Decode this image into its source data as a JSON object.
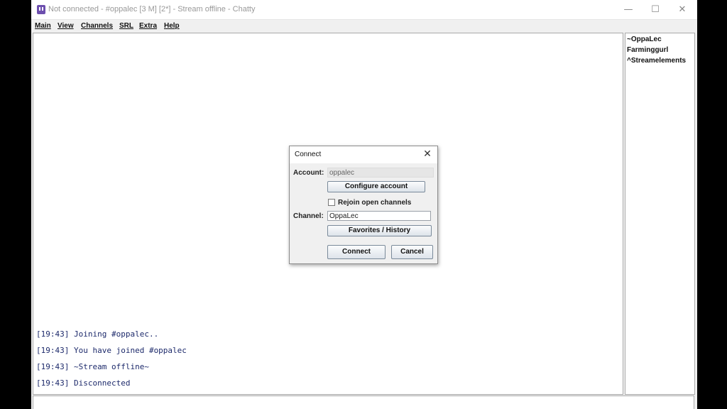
{
  "window": {
    "title": "Not connected - #oppalec [3 M] [2*] - Stream offline - Chatty",
    "controls": {
      "minimize": "—",
      "maximize": "☐",
      "close": "✕"
    }
  },
  "menu": {
    "items": [
      {
        "label": "Main"
      },
      {
        "label": "View"
      },
      {
        "label": "Channels"
      },
      {
        "label": "SRL"
      },
      {
        "label": "Extra"
      },
      {
        "label": "Help"
      }
    ]
  },
  "chat": {
    "lines": [
      {
        "text": "[19:43] Joining #oppalec.."
      },
      {
        "text": "[19:43] You have joined #oppalec"
      },
      {
        "text": "[19:43] ~Stream offline~"
      },
      {
        "text": "[19:43] Disconnected"
      }
    ]
  },
  "users": [
    {
      "name": "~OppaLec"
    },
    {
      "name": "Farminggurl"
    },
    {
      "name": "^Streamelements"
    }
  ],
  "dialog": {
    "title": "Connect",
    "close": "✕",
    "account_label": "Account:",
    "account_value": "oppalec",
    "configure_button": "Configure account",
    "rejoin_label": "Rejoin open channels",
    "channel_label": "Channel:",
    "channel_value": "OppaLec",
    "favorites_button": "Favorites / History",
    "connect_button": "Connect",
    "cancel_button": "Cancel"
  },
  "colors": {
    "chat_text": "#1d2a6b",
    "app_icon": "#6d4fae"
  }
}
